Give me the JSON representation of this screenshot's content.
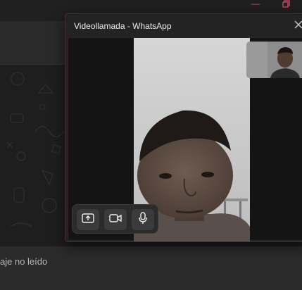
{
  "call_window": {
    "title": "Videollamada - WhatsApp",
    "close_icon": "close-icon",
    "controls": [
      {
        "name": "share-screen-button",
        "icon": "share-screen-icon"
      },
      {
        "name": "camera-button",
        "icon": "video-camera-icon"
      },
      {
        "name": "microphone-button",
        "icon": "microphone-icon"
      }
    ]
  },
  "background_app": {
    "footer_text": "aje no leído",
    "window_controls": [
      "minimize-icon",
      "restore-icon"
    ]
  },
  "colors": {
    "accent": "#d24a6a",
    "window_border": "#4a2a2a",
    "panel": "#2b2b2b"
  }
}
